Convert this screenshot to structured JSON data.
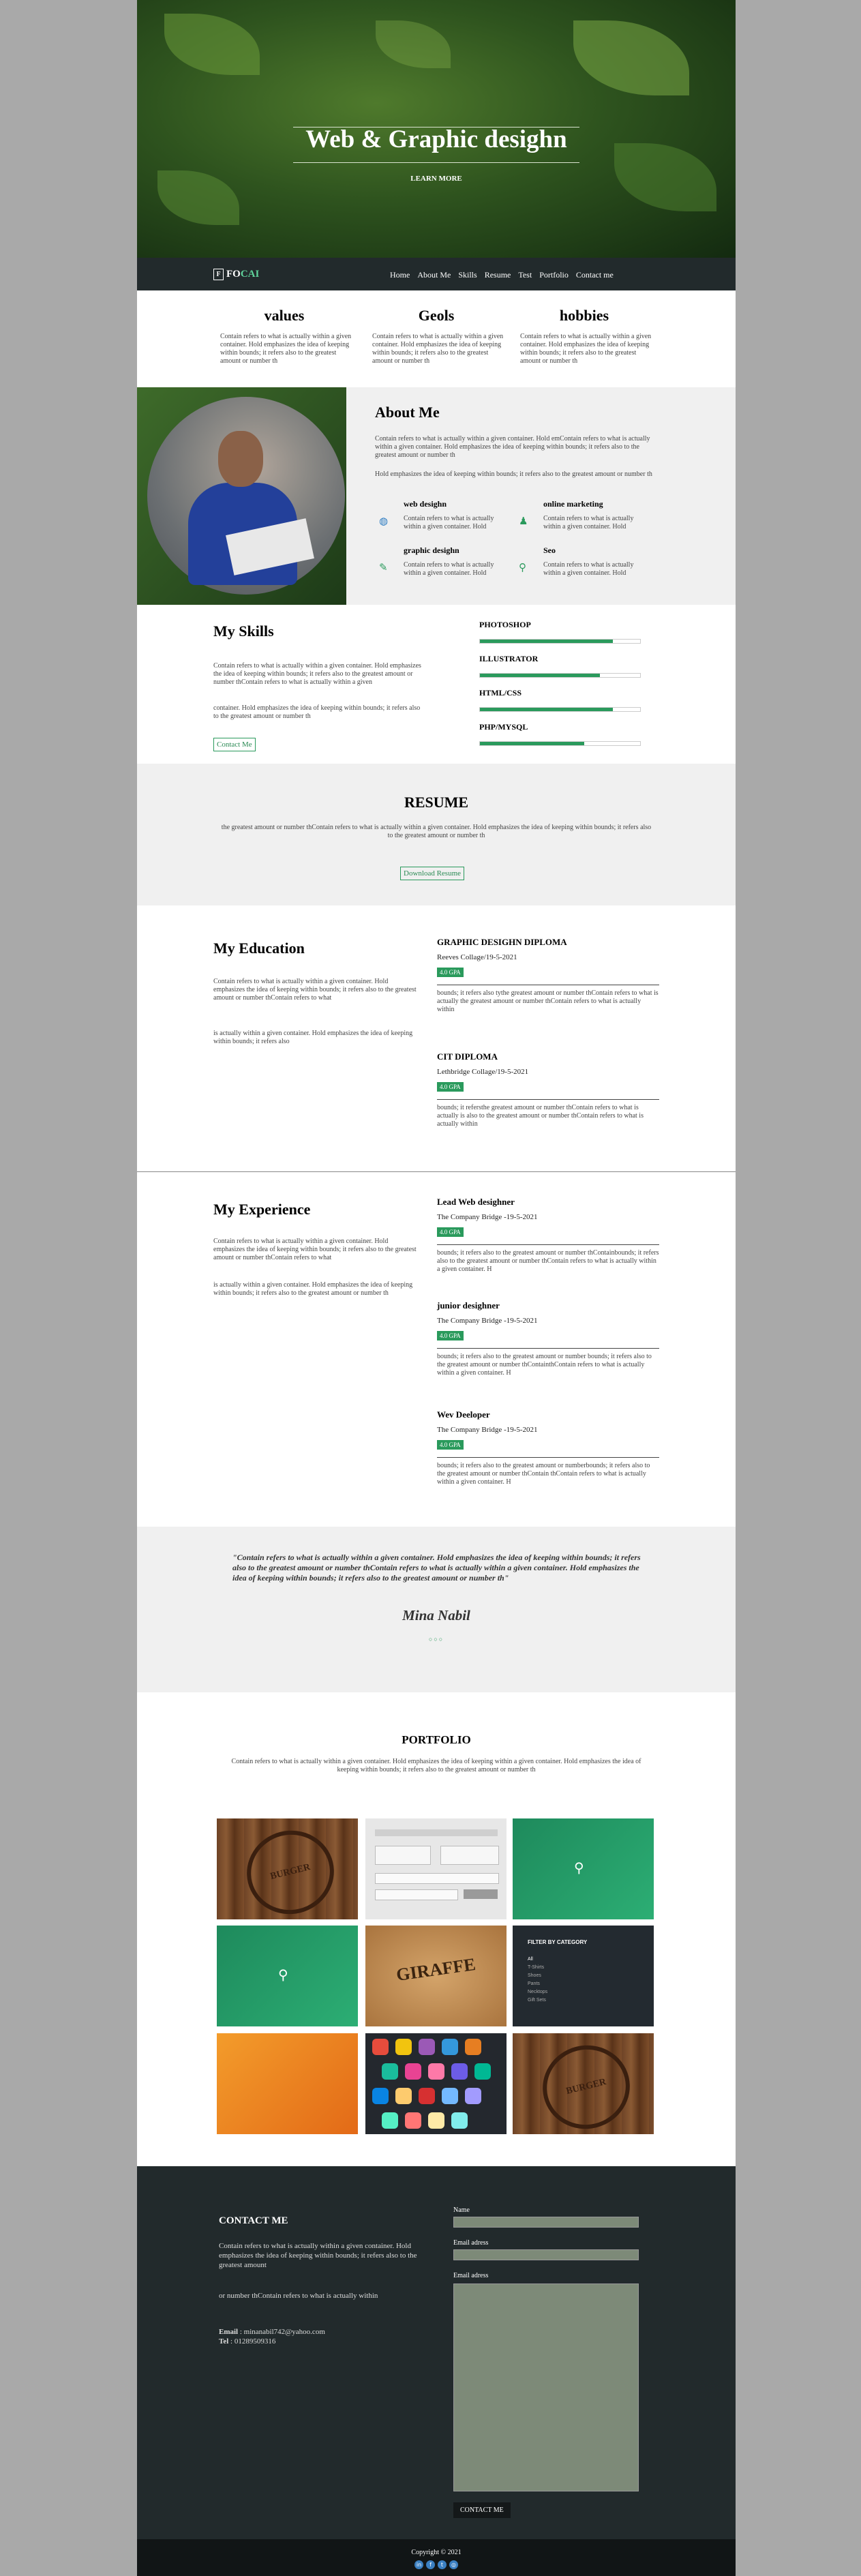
{
  "colors": {
    "accent": "#2a9a5c",
    "nav_bg": "#222a2c",
    "section_gray": "#f0f0f0",
    "page_bg": "#a9a9a9"
  },
  "hero": {
    "title": "Web & Graphic desighn",
    "button": "LEARN MORE"
  },
  "nav": {
    "logo_letter": "F",
    "logo_text": "FO",
    "logo_accent": "CAI",
    "items": [
      "Home",
      "About Me",
      "Skills",
      "Resume",
      "Test",
      "Portfolio",
      "Contact me"
    ]
  },
  "values": [
    {
      "title": "values",
      "text": "Contain refers to what is actually within a given container. Hold emphasizes the idea of keeping within bounds; it refers also to the greatest amount or number th"
    },
    {
      "title": "Geols",
      "text": "Contain refers to what is actually within a given container. Hold emphasizes the idea of keeping within bounds; it refers also to the greatest amount or number th"
    },
    {
      "title": "hobbies",
      "text": "Contain refers to what is actually within a given container. Hold emphasizes the idea of keeping within bounds; it refers also to the greatest amount or number th"
    }
  ],
  "about": {
    "title": "About Me",
    "p1": "Contain refers to what is actually within a given container. Hold emContain refers to what is actually within a given container. Hold emphasizes the idea of keeping within bounds; it refers also to the greatest amount or number th",
    "p2": "Hold emphasizes the idea of keeping within bounds; it refers also to the greatest amount or number th",
    "items": [
      {
        "title": "web desighn",
        "text": "Contain refers to what is actually within a given container. Hold",
        "icon": "globe-icon"
      },
      {
        "title": "online marketing",
        "text": "Contain refers to what is actually within a given container. Hold",
        "icon": "users-icon"
      },
      {
        "title": "graphic desighn",
        "text": "Contain refers to what is actually within a given container. Hold",
        "icon": "pencil-icon"
      },
      {
        "title": "Seo",
        "text": "Contain refers to what is actually within a given container. Hold",
        "icon": "search-icon"
      }
    ]
  },
  "skills": {
    "title": "My Skills",
    "p1": "Contain refers to what is actually within a given container. Hold emphasizes the idea of keeping within bounds; it refers also to the greatest amount or number thContain refers to what is actually within a given",
    "p2": "container. Hold emphasizes the idea of keeping within bounds; it refers also to the greatest amount or number th",
    "button": "Contact Me",
    "bars": [
      {
        "label": "PHOTOSHOP",
        "value": 0.83
      },
      {
        "label": "ILLUSTRATOR",
        "value": 0.75
      },
      {
        "label": "HTML/CSS",
        "value": 0.83
      },
      {
        "label": "PHP/MYSQL",
        "value": 0.65
      }
    ]
  },
  "resume": {
    "title": "RESUME",
    "text": "the greatest amount or number thContain refers to what is actually within a given container. Hold emphasizes the idea of keeping within bounds; it refers also to the greatest amount or number th",
    "button": "Download Resume"
  },
  "education": {
    "title": "My Education",
    "p1": "Contain refers to what is actually within a given container. Hold emphasizes the idea of keeping within bounds; it refers also to the greatest amount or number thContain refers to what",
    "p2": "is actually within a given container. Hold emphasizes the idea of keeping within bounds; it refers also",
    "entries": [
      {
        "title": "GRAPHIC DESIGHN DIPLOMA",
        "place": "Reeves Collage/19-5-2021",
        "gpa": "4.0 GPA",
        "text": "bounds; it refers also tythe greatest amount or number thContain refers to what is actually the greatest amount or number thContain refers to what is actually within"
      },
      {
        "title": "CIT DIPLOMA",
        "place": "Lethbridge Collage/19-5-2021",
        "gpa": "4.0 GPA",
        "text": "bounds; it refersthe greatest amount or number thContain refers to what is actually is also to the greatest amount or number thContain refers to what is actually within"
      }
    ]
  },
  "experience": {
    "title": "My Experience",
    "p1": "Contain refers to what is actually within a given container. Hold emphasizes the idea of keeping within bounds; it refers also to the greatest amount or number thContain refers to what",
    "p2": "is actually within a given container. Hold emphasizes the idea of keeping within bounds; it refers also to the greatest amount or number th",
    "entries": [
      {
        "title": "Lead Web desighner",
        "place": "The Company Bridge -19-5-2021",
        "gpa": "4.0 GPA",
        "text": "bounds; it refers also to the greatest amount or number thContainbounds; it refers also to the greatest amount or number thContain refers to what is actually within a given container. H"
      },
      {
        "title": "junior desighner",
        "place": "The Company Bridge -19-5-2021",
        "gpa": "4.0 GPA",
        "text": "bounds; it refers also to the greatest amount or number bounds; it refers also to the greatest amount or number thContainthContain refers to what is actually within a given container. H"
      },
      {
        "title": "Wev Deeloper",
        "place": "The Company Bridge -19-5-2021",
        "gpa": "4.0 GPA",
        "text": "bounds; it refers also to the greatest amount or numberbounds; it refers also to the greatest amount or number thContain thContain refers to what is actually within a given container. H"
      }
    ]
  },
  "quote": {
    "text": "\"Contain refers to what is actually within a given container. Hold emphasizes the idea of keeping within bounds; it refers also to the greatest amount or number thContain refers to what is actually within a given container. Hold emphasizes the idea of keeping within bounds; it refers also to the greatest amount or number th\"",
    "name": "Mina Nabil"
  },
  "portfolio": {
    "title": "PORTFOLIO",
    "text": "Contain refers to what is actually within a given container. Hold emphasizes the idea of keeping within a given container. Hold emphasizes the idea of keeping within bounds; it refers also to the greatest amount or number th",
    "stamp1": "BURGER",
    "stamp2": "BURGER",
    "giraffe": "GIRAFFE",
    "filter_title": "FILTER BY CATEGORY",
    "filters": [
      "All",
      "T-Shirts",
      "Shoes",
      "Pants",
      "Necktops",
      "Gift Sets"
    ]
  },
  "contact": {
    "title": "CONTACT ME",
    "p1": "Contain refers to what is actually within a given container. Hold emphasizes the idea of keeping within bounds; it refers also to the greatest amount",
    "p2": "or number thContain refers to what is actually within",
    "email_label": "Email",
    "email": " : minanabil742@yahoo.com",
    "tel_label": "Tel",
    "tel": " : 01289509316",
    "name_label": "Name",
    "email_field_label": "Email adress",
    "email_field_label2": "Email adress",
    "send": "CONTACT ME"
  },
  "footer": {
    "copyright": "Copyright © 2021",
    "socials": [
      "linkedin-icon",
      "facebook-icon",
      "twitter-icon",
      "instagram-icon"
    ]
  }
}
